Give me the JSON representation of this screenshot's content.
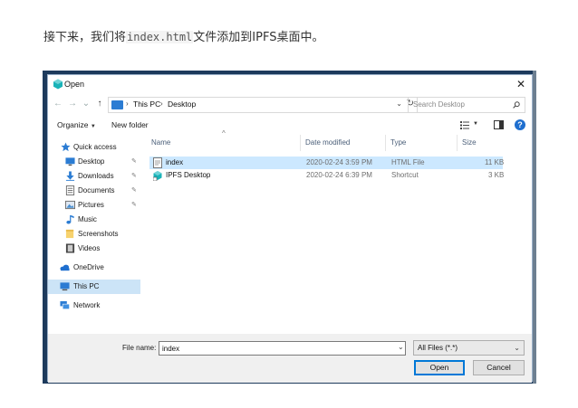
{
  "article": {
    "intro_before": "接下来，我们将",
    "intro_code": "index.html",
    "intro_after": "文件添加到IPFS桌面中。"
  },
  "dialog": {
    "title": "Open",
    "close_glyph": "✕",
    "nav": {
      "back_glyph": "←",
      "forward_glyph": "→",
      "recent_glyph": "⌄",
      "up_glyph": "↑",
      "breadcrumb": [
        "This PC",
        "Desktop"
      ],
      "search_placeholder": "Search Desktop"
    },
    "toolbar": {
      "organize_label": "Organize",
      "new_folder_label": "New folder"
    },
    "sidebar": {
      "items": [
        {
          "label": "Quick access",
          "icon": "star-icon",
          "pinned": false
        },
        {
          "label": "Desktop",
          "icon": "desktop-icon",
          "pinned": true
        },
        {
          "label": "Downloads",
          "icon": "download-icon",
          "pinned": true
        },
        {
          "label": "Documents",
          "icon": "document-icon",
          "pinned": true
        },
        {
          "label": "Pictures",
          "icon": "pictures-icon",
          "pinned": true
        },
        {
          "label": "Music",
          "icon": "music-icon",
          "pinned": false
        },
        {
          "label": "Screenshots",
          "icon": "folder-icon",
          "pinned": false
        },
        {
          "label": "Videos",
          "icon": "video-icon",
          "pinned": false
        },
        {
          "label": "OneDrive",
          "icon": "cloud-icon",
          "pinned": false
        },
        {
          "label": "This PC",
          "icon": "computer-icon",
          "pinned": false,
          "selected": true
        },
        {
          "label": "Network",
          "icon": "network-icon",
          "pinned": false
        }
      ],
      "pin_glyph": "📌"
    },
    "filelist": {
      "columns": [
        "Name",
        "Date modified",
        "Type",
        "Size"
      ],
      "rows": [
        {
          "name": "index",
          "date": "2020-02-24 3:59 PM",
          "type": "HTML File",
          "size": "11 KB",
          "icon": "html-file-icon",
          "selected": true
        },
        {
          "name": "IPFS Desktop",
          "date": "2020-02-24 6:39 PM",
          "type": "Shortcut",
          "size": "3 KB",
          "icon": "ipfs-shortcut-icon",
          "selected": false
        }
      ]
    },
    "bottom": {
      "file_name_label": "File name:",
      "file_name_value": "index",
      "file_type_value": "All Files (*.*)",
      "open_label": "Open",
      "cancel_label": "Cancel"
    }
  },
  "colors": {
    "frame": "#1d3a5c",
    "selection": "#cce8ff",
    "accent": "#0078d7",
    "ipfs": "#1ab3b8"
  }
}
